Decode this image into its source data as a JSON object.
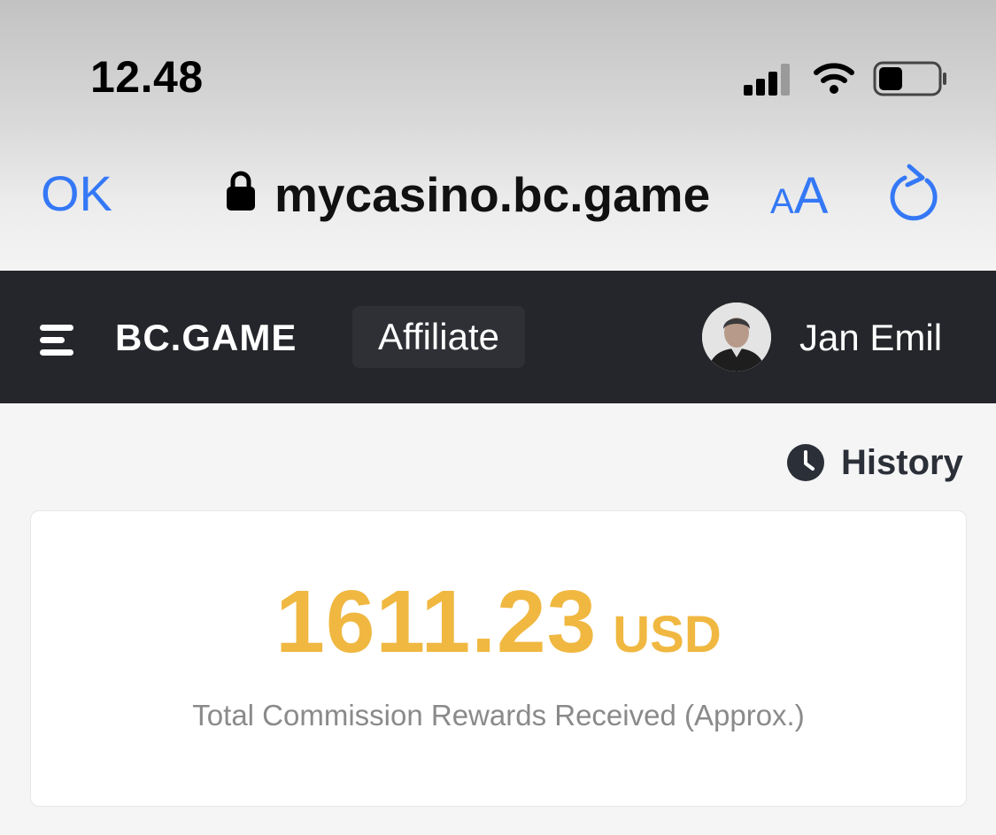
{
  "status_bar": {
    "time": "12.48",
    "icons": [
      "cellular-signal-icon",
      "wifi-icon",
      "battery-icon"
    ]
  },
  "browser": {
    "done_label": "OK",
    "url": "mycasino.bc.game",
    "text_size_small": "A",
    "text_size_big": "A",
    "accent_color": "#3478f6",
    "icons": [
      "lock-icon",
      "reload-icon"
    ]
  },
  "nav": {
    "brand": "BC.GAME",
    "active_tab": "Affiliate",
    "user_name": "Jan Emil",
    "background_color": "#25262b",
    "icons": [
      "hamburger-menu-icon",
      "avatar"
    ]
  },
  "content": {
    "history_label": "History",
    "commission": {
      "amount": "1611.23",
      "currency": "USD",
      "caption": "Total Commission Rewards Received (Approx.)",
      "amount_color": "#f0b841"
    }
  }
}
